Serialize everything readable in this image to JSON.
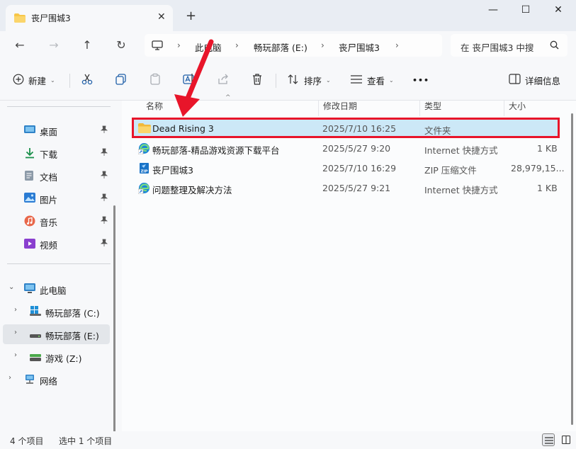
{
  "window": {
    "tab_title": "丧尸围城3",
    "new_tab_symbol": "+",
    "close_tab_symbol": "✕",
    "controls": {
      "minimize": "—",
      "maximize": "☐",
      "close": "✕"
    }
  },
  "nav": {
    "back": "←",
    "forward": "→",
    "up": "↑",
    "refresh": "↻",
    "breadcrumbs": [
      "此电脑",
      "畅玩部落 (E:)",
      "丧尸围城3"
    ],
    "search_placeholder": "在 丧尸围城3 中搜"
  },
  "toolbar": {
    "new_label": "新建",
    "sort_label": "排序",
    "view_label": "查看",
    "more_label": "•••",
    "details_label": "详细信息"
  },
  "sidebar": {
    "quick": [
      {
        "label": "桌面",
        "icon": "desktop-icon"
      },
      {
        "label": "下载",
        "icon": "download-icon"
      },
      {
        "label": "文档",
        "icon": "document-icon"
      },
      {
        "label": "图片",
        "icon": "pictures-icon"
      },
      {
        "label": "音乐",
        "icon": "music-icon"
      },
      {
        "label": "视频",
        "icon": "video-icon"
      }
    ],
    "this_pc": "此电脑",
    "drives": [
      {
        "label": "畅玩部落 (C:)"
      },
      {
        "label": "畅玩部落 (E:)"
      },
      {
        "label": "游戏 (Z:)"
      }
    ],
    "network": "网络"
  },
  "columns": {
    "name": "名称",
    "date": "修改日期",
    "type": "类型",
    "size": "大小"
  },
  "files": [
    {
      "name": "Dead Rising 3",
      "date": "2025/7/10 16:25",
      "type": "文件夹",
      "size": "",
      "icon": "folder-icon"
    },
    {
      "name": "畅玩部落-精品游戏资源下载平台",
      "date": "2025/5/27 9:20",
      "type": "Internet 快捷方式",
      "size": "1 KB",
      "icon": "edge-shortcut-icon"
    },
    {
      "name": "丧尸围城3",
      "date": "2025/7/10 16:29",
      "type": "ZIP 压缩文件",
      "size": "28,979,15...",
      "icon": "zip-icon"
    },
    {
      "name": "问题整理及解决方法",
      "date": "2025/5/27 9:21",
      "type": "Internet 快捷方式",
      "size": "1 KB",
      "icon": "edge-shortcut-icon"
    }
  ],
  "status": {
    "count": "4 个项目",
    "selected": "选中 1 个项目"
  },
  "colors": {
    "highlight": "#e8152a",
    "selection": "#cce8f7",
    "folder": "#f7c648"
  }
}
